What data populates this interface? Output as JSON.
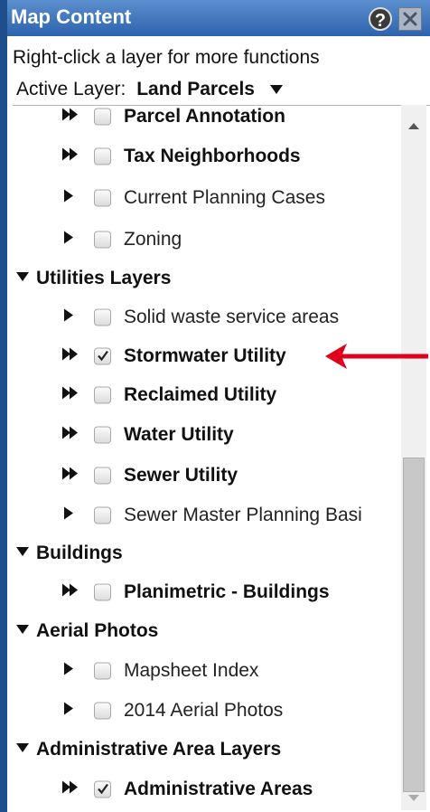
{
  "panel": {
    "title": "Map Content",
    "help_icon": "?",
    "info_text": "Right-click a layer for more functions",
    "active_layer_label": "Active Layer:",
    "active_layer_value": "Land Parcels"
  },
  "layers": [
    {
      "label": "Parcel Annotation",
      "bold": true,
      "checked": false,
      "expand": "double",
      "level": 1
    },
    {
      "label": "Tax Neighborhoods",
      "bold": true,
      "checked": false,
      "expand": "double",
      "level": 1
    },
    {
      "label": "Current Planning Cases",
      "bold": false,
      "checked": false,
      "expand": "single",
      "level": 1
    },
    {
      "label": "Zoning",
      "bold": false,
      "checked": false,
      "expand": "single",
      "level": 1
    },
    {
      "label": "Utilities Layers",
      "group": true
    },
    {
      "label": "Solid waste service areas",
      "bold": false,
      "checked": false,
      "expand": "single",
      "level": 1
    },
    {
      "label": "Stormwater Utility",
      "bold": true,
      "checked": true,
      "expand": "double",
      "level": 1,
      "highlighted": true
    },
    {
      "label": "Reclaimed Utility",
      "bold": true,
      "checked": false,
      "expand": "double",
      "level": 1
    },
    {
      "label": "Water Utility",
      "bold": true,
      "checked": false,
      "expand": "double",
      "level": 1
    },
    {
      "label": "Sewer Utility",
      "bold": true,
      "checked": false,
      "expand": "double",
      "level": 1
    },
    {
      "label": "Sewer Master Planning Basi",
      "bold": false,
      "checked": false,
      "expand": "single",
      "level": 1
    },
    {
      "label": "Buildings",
      "group": true
    },
    {
      "label": "Planimetric - Buildings",
      "bold": true,
      "checked": false,
      "expand": "double",
      "level": 1
    },
    {
      "label": "Aerial Photos",
      "group": true
    },
    {
      "label": "Mapsheet Index",
      "bold": false,
      "checked": false,
      "expand": "single",
      "level": 1
    },
    {
      "label": "2014 Aerial Photos",
      "bold": false,
      "checked": false,
      "expand": "single",
      "level": 1
    },
    {
      "label": "Administrative Area Layers",
      "group": true
    },
    {
      "label": "Administrative Areas",
      "bold": true,
      "checked": true,
      "expand": "double",
      "level": 1
    }
  ],
  "colors": {
    "title_bar": "#2d63ad",
    "frame": "#1f4e8c",
    "annotation_arrow": "#e0001b"
  }
}
